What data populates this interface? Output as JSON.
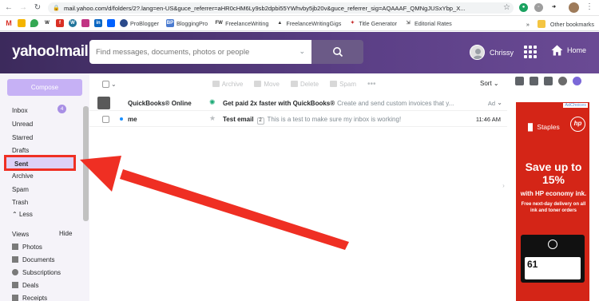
{
  "browser": {
    "url": "mail.yahoo.com/d/folders/2?.lang=en-US&guce_referrer=aHR0cHM6Ly9sb2dpbi55YWhvby5jb20v&guce_referrer_sig=AQAAAF_QMNgJUSxYbp_X...",
    "bookmarks": [
      "ProBlogger",
      "BloggingPro",
      "FreelanceWriting",
      "FreelanceWritingGigs",
      "Title Generator",
      "Editorial Rates"
    ],
    "other_bookmarks": "Other bookmarks"
  },
  "header": {
    "logo": "yahoo!mail",
    "search_placeholder": "Find messages, documents, photos or people",
    "user_name": "Chrissy",
    "home_label": "Home"
  },
  "sidebar": {
    "compose_label": "Compose",
    "folders": {
      "inbox": "Inbox",
      "inbox_count": "4",
      "unread": "Unread",
      "starred": "Starred",
      "drafts": "Drafts",
      "sent": "Sent",
      "archive": "Archive",
      "spam": "Spam",
      "trash": "Trash",
      "less": "Less"
    },
    "views": {
      "label": "Views",
      "hide": "Hide",
      "photos": "Photos",
      "documents": "Documents",
      "subscriptions": "Subscriptions",
      "deals": "Deals",
      "receipts": "Receipts"
    }
  },
  "toolbar": {
    "archive": "Archive",
    "move": "Move",
    "delete": "Delete",
    "spam": "Spam",
    "sort": "Sort"
  },
  "messages": [
    {
      "sender": "QuickBooks® Online",
      "subject": "Get paid 2x faster with QuickBooks®",
      "preview": "Create and send custom invoices that y...",
      "badge": "Ad"
    },
    {
      "sender": "me",
      "subject": "Test email",
      "thread_count": "2",
      "preview": "This is a test to make sure my inbox is working!",
      "time": "11:46 AM"
    }
  ],
  "ad": {
    "adchoices": "AdChoices",
    "brand": "Staples",
    "partner": "hp",
    "headline": "Save up to 15%",
    "sub": "with HP economy ink.",
    "fine": "Free next-day delivery on all ink and toner orders",
    "ink_number": "61"
  },
  "colors": {
    "header_purple": "#4b3474",
    "compose": "#c6b1f5",
    "annotation_red": "#ef2f23",
    "ad_red": "#d42517"
  }
}
